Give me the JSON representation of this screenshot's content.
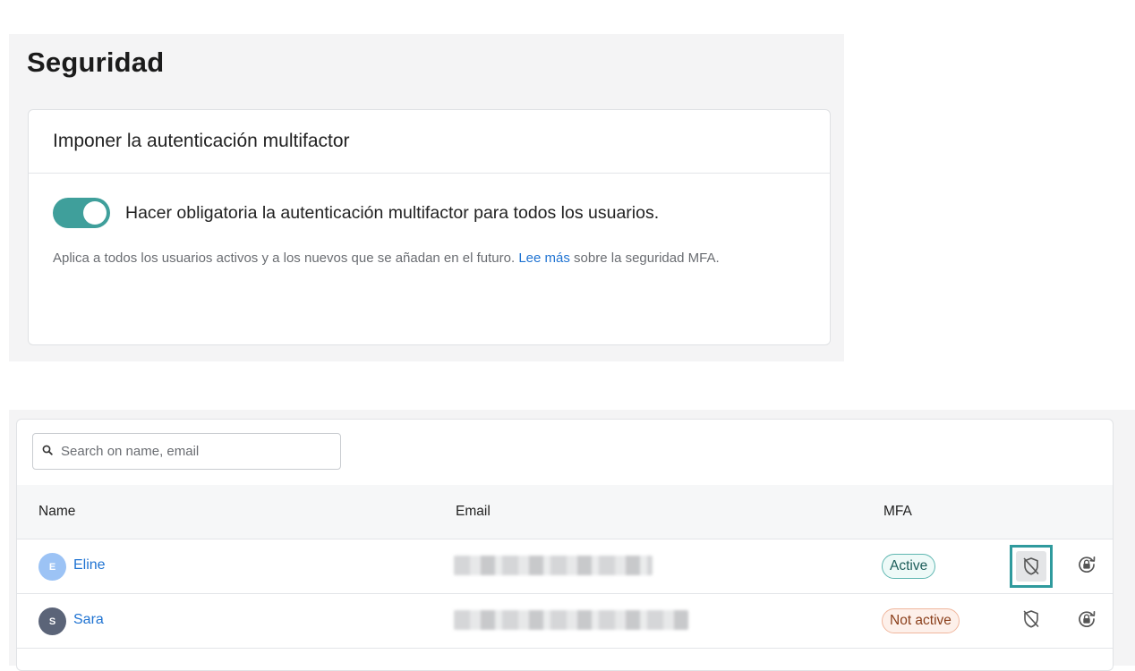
{
  "security": {
    "title": "Seguridad",
    "card_title": "Imponer la autenticación multifactor",
    "toggle_label": "Hacer obligatoria la autenticación multifactor para todos los usuarios.",
    "toggle_on": true,
    "desc_before": "Aplica a todos los usuarios activos y a los nuevos que se añadan en el futuro. ",
    "desc_link": "Lee más",
    "desc_after": " sobre la seguridad MFA."
  },
  "users": {
    "search": {
      "placeholder": "Search on name, email",
      "value": ""
    },
    "columns": {
      "name": "Name",
      "email": "Email",
      "mfa": "MFA"
    },
    "rows": [
      {
        "initial": "E",
        "name": "Eline",
        "email": "",
        "mfa": "Active",
        "avatar_color": "#9cc3f5"
      },
      {
        "initial": "S",
        "name": "Sara",
        "email": "",
        "mfa": "Not active",
        "avatar_color": "#5b6478"
      }
    ]
  },
  "icons": {
    "search": "search-icon",
    "toggle_mfa": "shield-off-icon",
    "reset_mfa": "lock-reset-icon"
  },
  "colors": {
    "accent": "#3f9f9b",
    "link": "#1f73d2",
    "active_badge": "#5fb7b1",
    "inactive_badge": "#f0b79e"
  }
}
